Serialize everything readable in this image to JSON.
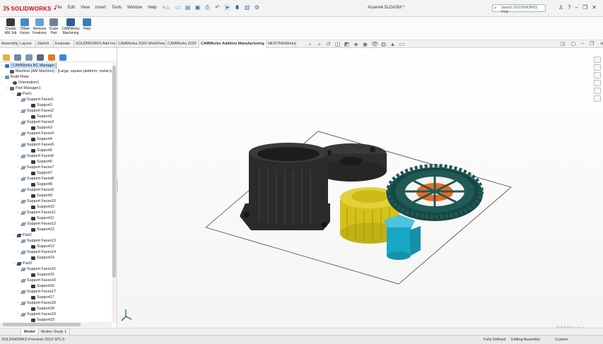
{
  "app": {
    "logo_mark": "3S",
    "logo_text": "SOLIDWORKS",
    "menu": [
      "File",
      "Edit",
      "View",
      "Insert",
      "Tools",
      "Window",
      "Help"
    ],
    "doc_title": "Assem4.SLDASM *",
    "search_placeholder": "Search SOLIDWORKS Help"
  },
  "command_bar": [
    {
      "label": "Create AM Job",
      "color": "#3a3a3a"
    },
    {
      "label": "Offset Faces",
      "color": "#4a86c5"
    },
    {
      "label": "Remove Features",
      "color": "#6aa0d0"
    },
    {
      "label": "Scale Part",
      "color": "#6e8194"
    },
    {
      "label": "CAMWorks Machining",
      "color": "#2e5f93"
    },
    {
      "label": "Help",
      "color": "#3c7bc0"
    }
  ],
  "tabs": [
    {
      "label": "Assembly",
      "active": false
    },
    {
      "label": "Layout",
      "active": false
    },
    {
      "label": "Sketch",
      "active": false
    },
    {
      "label": "Evaluate",
      "active": false
    },
    {
      "label": "SOLIDWORKS Add-Ins",
      "active": false
    },
    {
      "label": "CAMWorks 2020-WorkFlow",
      "active": false
    },
    {
      "label": "CAMWorks 2020",
      "active": false
    },
    {
      "label": "CAMWorks Additive Manufacturing",
      "active": true
    },
    {
      "label": "NESTINGWorks",
      "active": false
    }
  ],
  "tree": {
    "root": "CAMWorks NC Manager",
    "machine": "Machine [AM Machine] - [Large, square platform, metal po",
    "build_plate": "Build Plate",
    "orientation": "Orientation1",
    "part_manager": "Part Manager1",
    "parts": [
      {
        "name": "Part1",
        "supports": [
          {
            "faces": "Support Faces1",
            "support": "Support1"
          },
          {
            "faces": "Support Faces2",
            "support": "Support2"
          },
          {
            "faces": "Support Faces3",
            "support": "Support3"
          },
          {
            "faces": "Support Faces4",
            "support": "Support4"
          },
          {
            "faces": "Support Faces5",
            "support": "Support5"
          },
          {
            "faces": "Support Faces6",
            "support": "Support6"
          },
          {
            "faces": "Support Faces7",
            "support": "Support7"
          },
          {
            "faces": "Support Faces8",
            "support": "Support8"
          },
          {
            "faces": "Support Faces9",
            "support": "Support9"
          },
          {
            "faces": "Support Faces10",
            "support": "Support10"
          },
          {
            "faces": "Support Faces11",
            "support": "Support11"
          },
          {
            "faces": "Support Faces12",
            "support": "Support12"
          }
        ]
      },
      {
        "name": "Part2",
        "supports": [
          {
            "faces": "Support Faces13",
            "support": "Support13"
          },
          {
            "faces": "Support Faces14",
            "support": "Support14"
          }
        ]
      },
      {
        "name": "Part3",
        "supports": [
          {
            "faces": "Support Faces15",
            "support": "Support15"
          },
          {
            "faces": "Support Faces16",
            "support": "Support16"
          },
          {
            "faces": "Support Faces17",
            "support": "Support17"
          },
          {
            "faces": "Support Faces18",
            "support": "Support18"
          },
          {
            "faces": "Support Faces19",
            "support": "Support19"
          }
        ]
      }
    ]
  },
  "bottom_tabs": [
    {
      "label": "Model",
      "active": true
    },
    {
      "label": "Motion Study 1",
      "active": false
    }
  ],
  "status": {
    "left": "SOLIDWORKS Premium 2019 SP1.0",
    "defined": "Fully Defined",
    "mode": "Editing Assembly",
    "units": "Custom"
  },
  "watermark": "CAMWorks",
  "part_colors": {
    "housing": "#2b2b2b",
    "plate_part": "#3a3a3a",
    "yellow_gear": "#d4c21a",
    "cyan_part": "#1aa7c6",
    "green_gear": "#1f5a57",
    "orange_hub": "#f06a1a"
  }
}
